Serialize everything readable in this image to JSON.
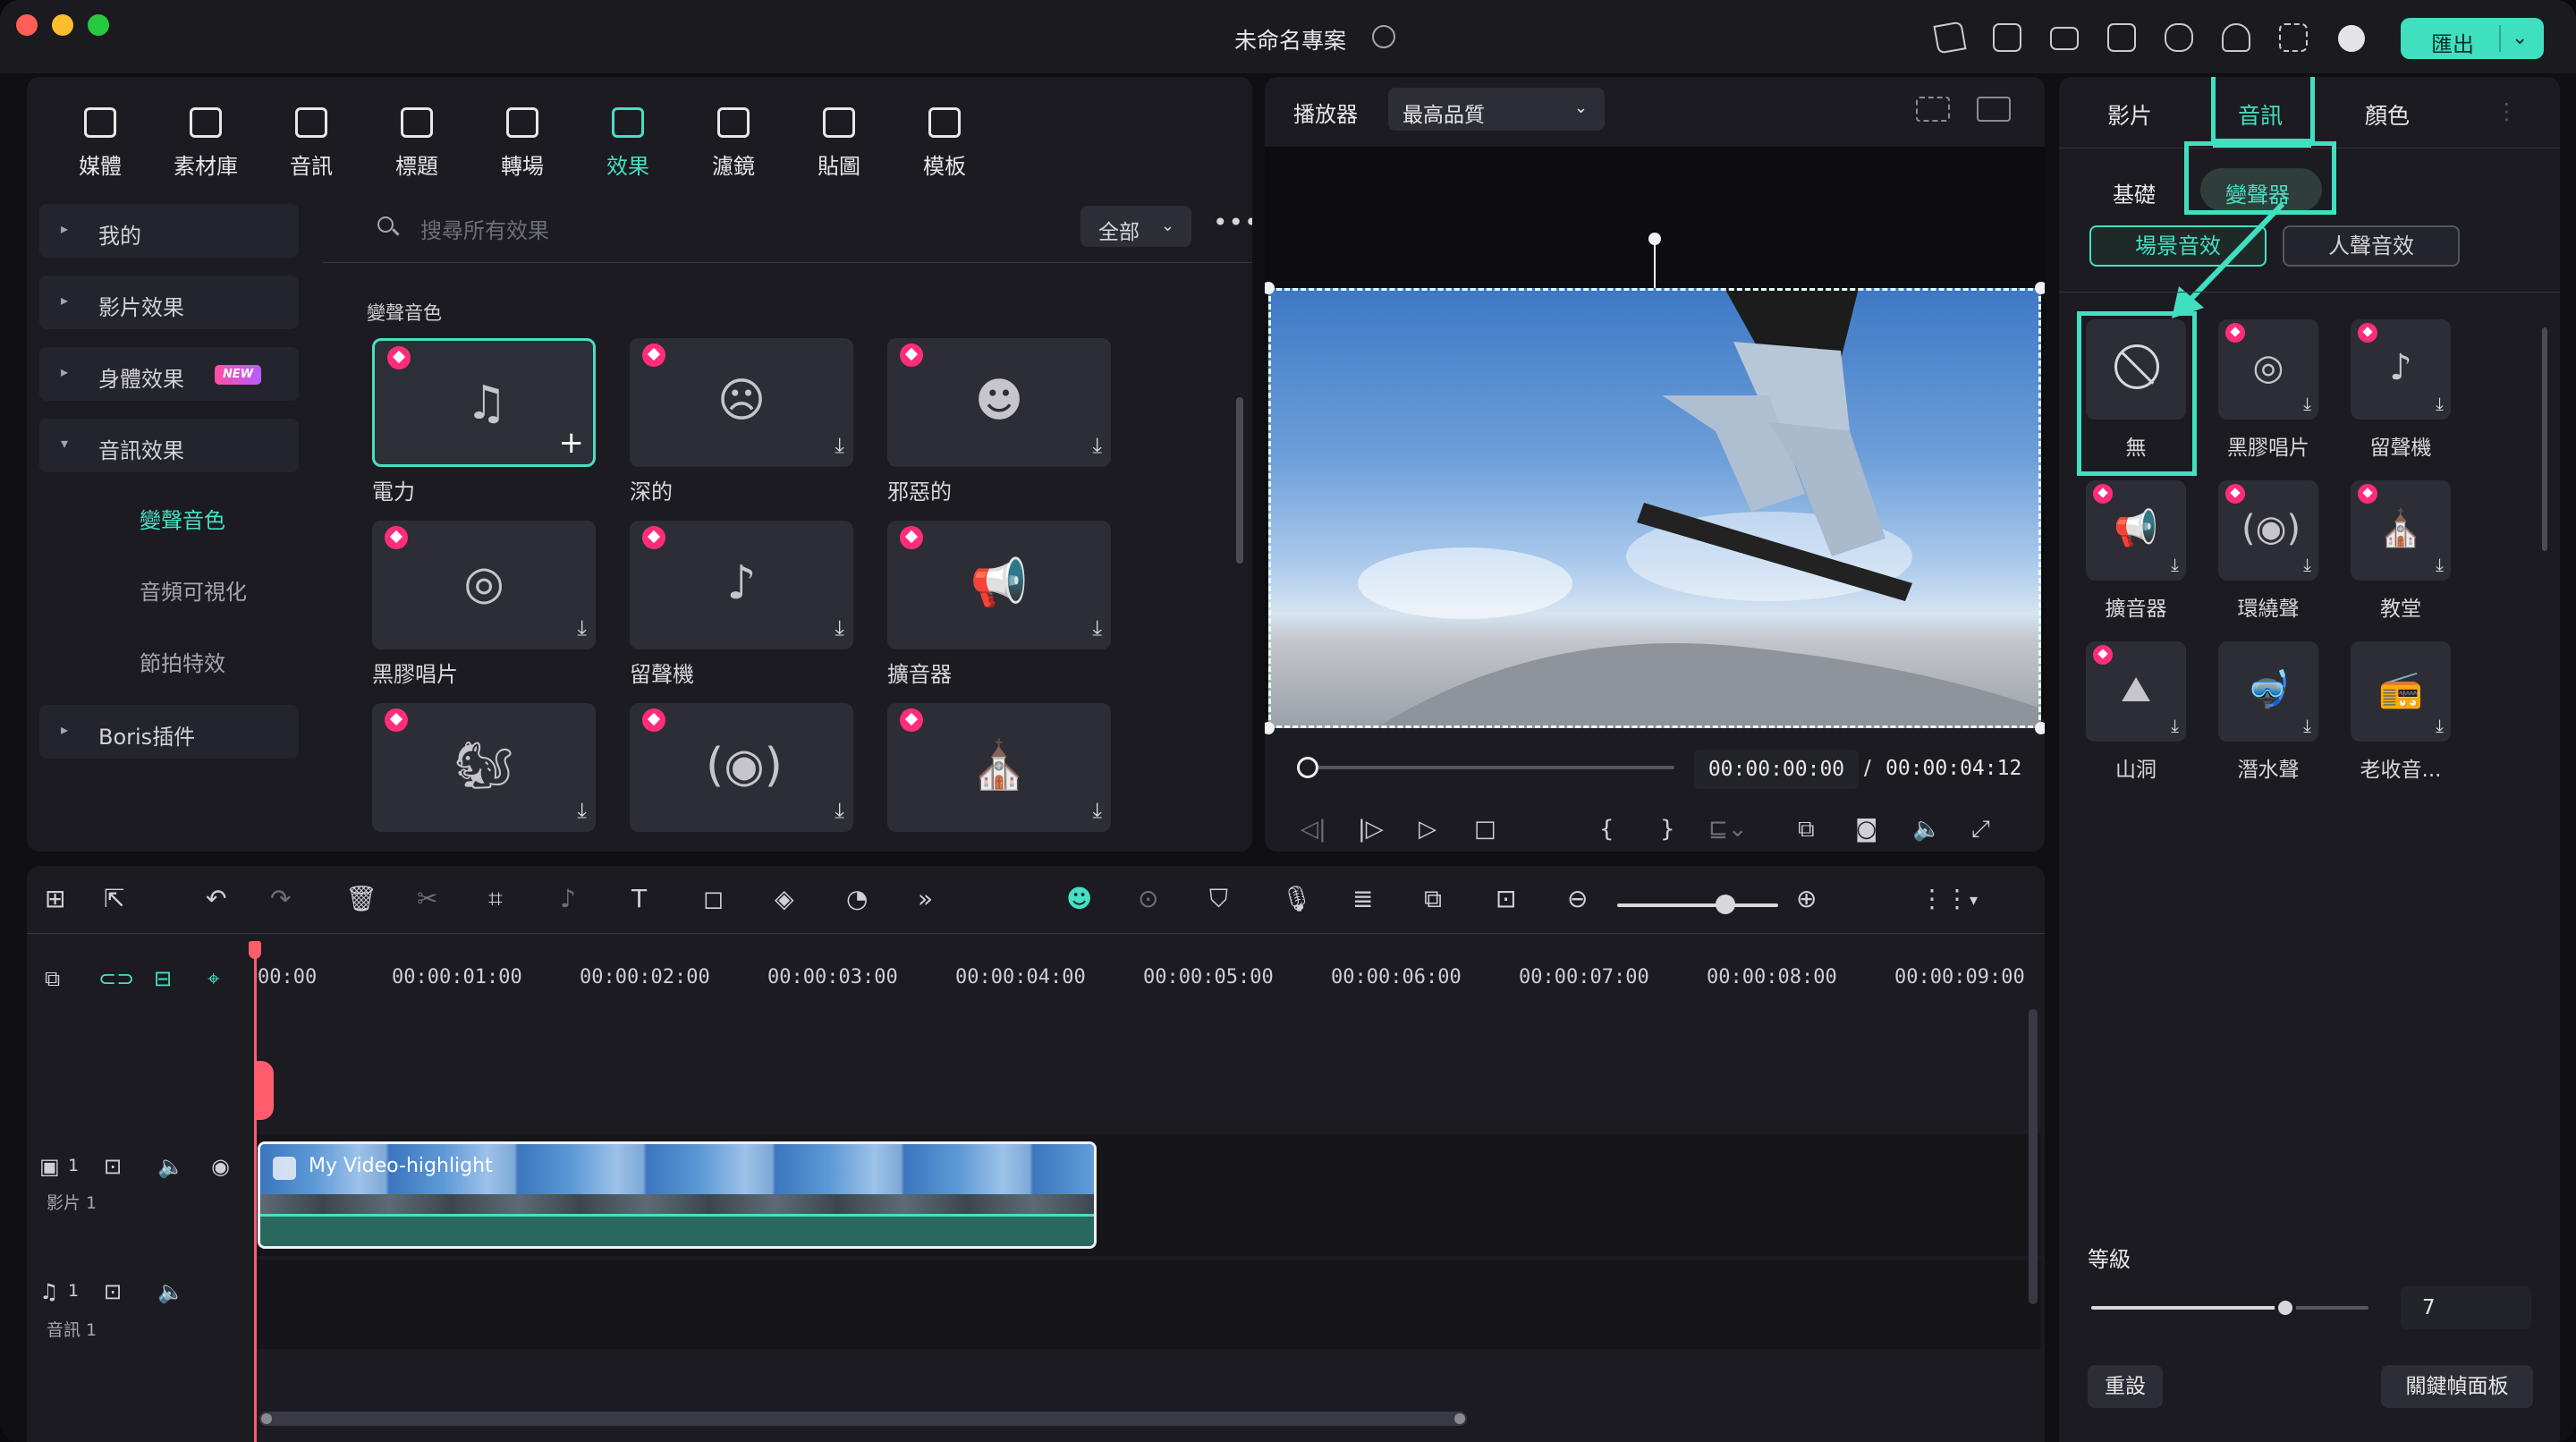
{
  "titlebar": {
    "project_title": "未命名專案",
    "export_label": "匯出",
    "accent_color": "#3fe0c0"
  },
  "library": {
    "tabs": [
      {
        "label": "媒體",
        "icon": "media-icon"
      },
      {
        "label": "素材庫",
        "icon": "stock-library-icon"
      },
      {
        "label": "音訊",
        "icon": "music-note-icon"
      },
      {
        "label": "標題",
        "icon": "title-t-icon"
      },
      {
        "label": "轉場",
        "icon": "transition-icon"
      },
      {
        "label": "效果",
        "icon": "effects-sparkle-icon",
        "active": true
      },
      {
        "label": "濾鏡",
        "icon": "filter-icon"
      },
      {
        "label": "貼圖",
        "icon": "sticker-icon"
      },
      {
        "label": "模板",
        "icon": "template-icon"
      }
    ],
    "sidebar": {
      "items": [
        {
          "label": "我的"
        },
        {
          "label": "影片效果"
        },
        {
          "label": "身體效果",
          "badge": "NEW"
        },
        {
          "label": "音訊效果",
          "expanded": true
        },
        {
          "label": "Boris插件"
        }
      ],
      "sub_items": [
        {
          "label": "變聲音色",
          "active": true
        },
        {
          "label": "音頻可視化"
        },
        {
          "label": "節拍特效"
        }
      ]
    },
    "search": {
      "placeholder": "搜尋所有效果",
      "filter": "全部",
      "more": "•••"
    },
    "section_title": "變聲音色",
    "effects": [
      {
        "name": "電力",
        "icon": "♫",
        "selected": true,
        "premium": true
      },
      {
        "name": "深的",
        "icon": "☹",
        "premium": true
      },
      {
        "name": "邪惡的",
        "icon": "☻",
        "premium": true
      },
      {
        "name": "黑膠唱片",
        "icon": "◎",
        "premium": true
      },
      {
        "name": "留聲機",
        "icon": "♪",
        "premium": true
      },
      {
        "name": "擴音器",
        "icon": "📢",
        "premium": true
      },
      {
        "name": "",
        "icon": "🐿",
        "premium": true
      },
      {
        "name": "",
        "icon": "(◉)",
        "premium": true
      },
      {
        "name": "",
        "icon": "⛪",
        "premium": true
      }
    ]
  },
  "player": {
    "label": "播放器",
    "quality": "最高品質",
    "current_time": "00:00:00:00",
    "separator": "/",
    "total_time": "00:00:04:12"
  },
  "inspector": {
    "tabs": [
      {
        "label": "影片"
      },
      {
        "label": "音訊",
        "active": true
      },
      {
        "label": "顏色"
      }
    ],
    "subtabs": [
      {
        "label": "基礎"
      },
      {
        "label": "變聲器",
        "active": true
      }
    ],
    "pills": [
      {
        "label": "場景音效",
        "active": true
      },
      {
        "label": "人聲音效"
      }
    ],
    "voice_effects": [
      {
        "name": "無",
        "icon": "none-icon",
        "selected": true,
        "premium": false
      },
      {
        "name": "黑膠唱片",
        "icon": "◎",
        "premium": true
      },
      {
        "name": "留聲機",
        "icon": "♪",
        "premium": true
      },
      {
        "name": "擴音器",
        "icon": "📢",
        "premium": true
      },
      {
        "name": "環繞聲",
        "icon": "(◉)",
        "premium": true
      },
      {
        "name": "教堂",
        "icon": "⛪",
        "premium": true
      },
      {
        "name": "山洞",
        "icon": "⛰",
        "premium": true
      },
      {
        "name": "潛水聲",
        "icon": "🤿",
        "premium": false
      },
      {
        "name": "老收音...",
        "icon": "📻",
        "premium": false
      }
    ],
    "level_label": "等級",
    "level_value": "7",
    "level_fraction": 0.7,
    "reset_label": "重設",
    "keyframe_label": "關鍵幀面板"
  },
  "timeline": {
    "ruler": [
      "00:00",
      "00:00:01:00",
      "00:00:02:00",
      "00:00:03:00",
      "00:00:04:00",
      "00:00:05:00",
      "00:00:06:00",
      "00:00:07:00",
      "00:00:08:00",
      "00:00:09:00"
    ],
    "tracks": [
      {
        "name": "影片 1",
        "index": "1"
      },
      {
        "name": "音訊 1",
        "index": "1"
      }
    ],
    "clip_name": "My Video-highlight"
  }
}
